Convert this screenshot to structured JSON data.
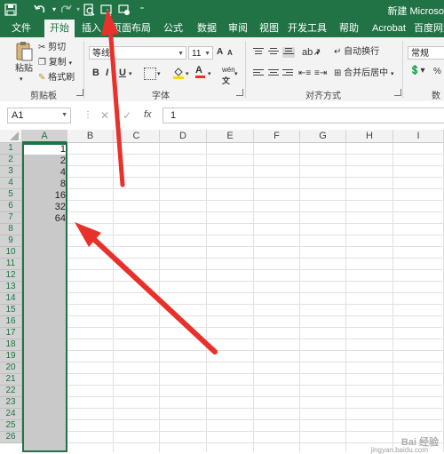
{
  "window": {
    "title": "新建 Microso"
  },
  "quick_access": [
    {
      "name": "save-icon"
    },
    {
      "name": "undo-icon"
    },
    {
      "name": "redo-icon"
    },
    {
      "name": "print-preview-icon"
    },
    {
      "name": "select-visible-icon"
    },
    {
      "name": "screenshot-icon"
    },
    {
      "name": "customize-qat-icon"
    }
  ],
  "tabs": [
    "文件",
    "开始",
    "插入",
    "页面布局",
    "公式",
    "数据",
    "审阅",
    "视图",
    "开发工具",
    "帮助",
    "Acrobat",
    "百度网盘"
  ],
  "active_tab": "开始",
  "ribbon": {
    "clipboard": {
      "paste": "粘贴",
      "cut": "剪切",
      "copy": "复制",
      "format_painter": "格式刷",
      "label": "剪贴板"
    },
    "font": {
      "name": "等线",
      "size": "11",
      "bold": "B",
      "italic": "I",
      "underline": "U",
      "grow": "A",
      "shrink": "A",
      "wen": "wén",
      "label": "字体"
    },
    "alignment": {
      "wrap": "自动换行",
      "merge": "合并后居中",
      "label": "对齐方式"
    },
    "number": {
      "format": "常规",
      "label": "数",
      "percent": "%"
    }
  },
  "formula_bar": {
    "cell_ref": "A1",
    "fx": "fx",
    "value": "1"
  },
  "columns": [
    "A",
    "B",
    "C",
    "D",
    "E",
    "F",
    "G",
    "H",
    "I"
  ],
  "rows": [
    "1",
    "2",
    "3",
    "4",
    "5",
    "6",
    "7",
    "8",
    "9",
    "10",
    "11",
    "12",
    "13",
    "14",
    "15",
    "16",
    "17",
    "18",
    "19",
    "20",
    "21",
    "22",
    "23",
    "24",
    "25",
    "26"
  ],
  "cells": [
    "1",
    "2",
    "4",
    "8",
    "16",
    "32",
    "64"
  ],
  "colors": {
    "excel_green": "#217346",
    "arrow_red": "#e8312a"
  },
  "watermark": {
    "brand": "Bai 经验",
    "url": "jingyan.baidu.com"
  }
}
